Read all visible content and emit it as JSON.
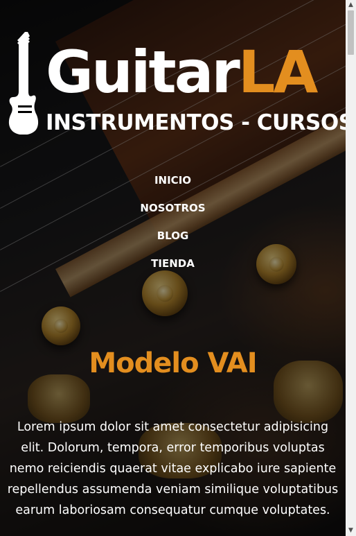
{
  "logo": {
    "title_main": "Guitar",
    "title_accent": "LA",
    "subtitle": "INSTRUMENTOS - CURSOS",
    "icon": "electric-guitar-icon"
  },
  "nav": {
    "items": [
      {
        "label": "INICIO"
      },
      {
        "label": "NOSOTROS"
      },
      {
        "label": "BLOG"
      },
      {
        "label": "TIENDA"
      }
    ]
  },
  "hero": {
    "model_title": "Modelo VAI",
    "description": "Lorem ipsum dolor sit amet consectetur adipisicing elit. Dolorum, tempora, error temporibus voluptas nemo reiciendis quaerat vitae explicabo iure sapiente repellendus assumenda veniam similique voluptatibus earum laboriosam consequatur cumque voluptates."
  },
  "scrollbar": {
    "up_icon": "scroll-up-arrow-icon",
    "down_icon": "scroll-down-arrow-icon"
  },
  "colors": {
    "accent": "#e38e1f",
    "text": "#ffffff",
    "background": "#000000"
  }
}
